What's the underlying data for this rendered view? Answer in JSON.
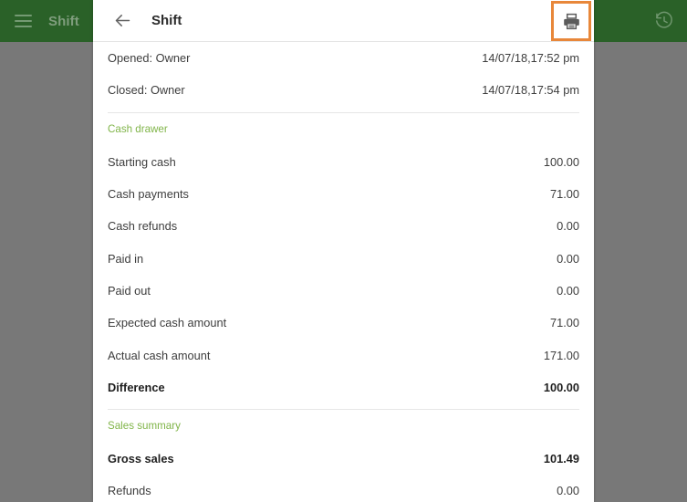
{
  "appbar": {
    "menu_icon": "hamburger-icon",
    "title": "Shift",
    "history_icon": "history-icon"
  },
  "sheet": {
    "back_icon": "back-arrow-icon",
    "title": "Shift",
    "print_icon": "printer-icon",
    "print_highlight_color": "#e8873a"
  },
  "colors": {
    "appbar_green": "#2a6128",
    "overlay_gray": "#787878",
    "section_green": "#81b54a",
    "highlight_orange": "#e8873a"
  },
  "content": {
    "shift_info": [
      {
        "label": "Opened: Owner",
        "value": "14/07/18,17:52 pm",
        "bold": false
      },
      {
        "label": "Closed: Owner",
        "value": "14/07/18,17:54 pm",
        "bold": false
      }
    ],
    "cash_drawer_heading": "Cash drawer",
    "cash_drawer": [
      {
        "label": "Starting cash",
        "value": "100.00",
        "bold": false
      },
      {
        "label": "Cash payments",
        "value": "71.00",
        "bold": false
      },
      {
        "label": "Cash refunds",
        "value": "0.00",
        "bold": false
      },
      {
        "label": "Paid in",
        "value": "0.00",
        "bold": false
      },
      {
        "label": "Paid out",
        "value": "0.00",
        "bold": false
      },
      {
        "label": "Expected cash amount",
        "value": "71.00",
        "bold": false
      },
      {
        "label": "Actual cash amount",
        "value": "171.00",
        "bold": false
      },
      {
        "label": "Difference",
        "value": "100.00",
        "bold": true
      }
    ],
    "sales_summary_heading": "Sales summary",
    "sales_summary": [
      {
        "label": "Gross sales",
        "value": "101.49",
        "bold": true
      },
      {
        "label": "Refunds",
        "value": "0.00",
        "bold": false
      }
    ]
  }
}
